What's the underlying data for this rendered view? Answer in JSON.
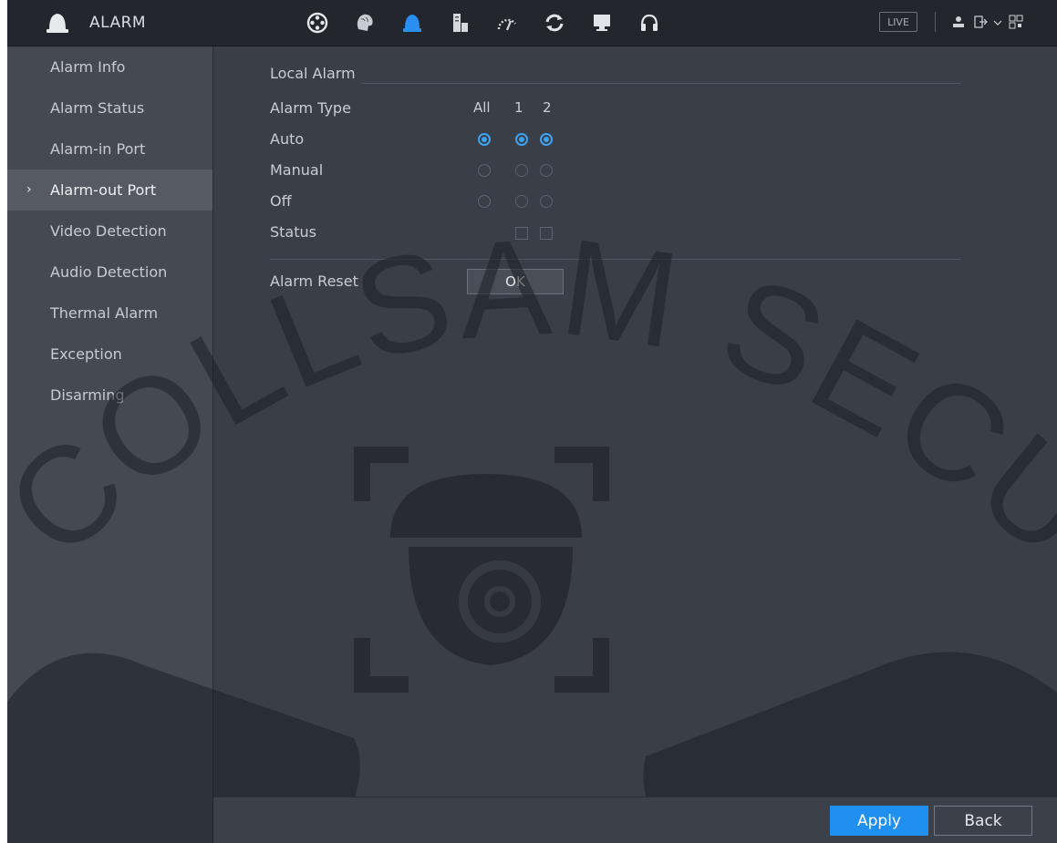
{
  "app": {
    "title": "ALARM",
    "live_label": "LIVE"
  },
  "toolbar": {
    "icons": [
      "camera-reel-icon",
      "brain-icon",
      "alarm-bell-icon",
      "storage-icon",
      "gauge-icon",
      "sync-icon",
      "monitor-icon",
      "headset-icon"
    ],
    "active_icon": "alarm-bell-icon"
  },
  "sidebar": {
    "items": [
      {
        "label": "Alarm Info"
      },
      {
        "label": "Alarm Status"
      },
      {
        "label": "Alarm-in Port"
      },
      {
        "label": "Alarm-out Port",
        "active": true
      },
      {
        "label": "Video Detection"
      },
      {
        "label": "Audio Detection"
      },
      {
        "label": "Thermal Alarm"
      },
      {
        "label": "Exception"
      },
      {
        "label": "Disarming"
      }
    ],
    "chevron": "›"
  },
  "main": {
    "section_title": "Local Alarm",
    "alarm_type_label": "Alarm Type",
    "columns": [
      "All",
      "1",
      "2"
    ],
    "rows": [
      {
        "label": "Auto",
        "selected": [
          true,
          true,
          true
        ]
      },
      {
        "label": "Manual",
        "selected": [
          false,
          false,
          false
        ]
      },
      {
        "label": "Off",
        "selected": [
          false,
          false,
          false
        ]
      }
    ],
    "status_label": "Status",
    "status_checked": [
      false,
      false
    ],
    "alarm_reset_label": "Alarm Reset",
    "ok_label": "OK"
  },
  "footer": {
    "apply_label": "Apply",
    "back_label": "Back"
  },
  "watermark": {
    "text": "COLLSAM SECURITY"
  },
  "colors": {
    "accent": "#1f8ff0",
    "radio_on": "#3fa2f0",
    "topbar": "#23272d",
    "panel": "#3a3f47",
    "sidebar": "#454a52"
  }
}
